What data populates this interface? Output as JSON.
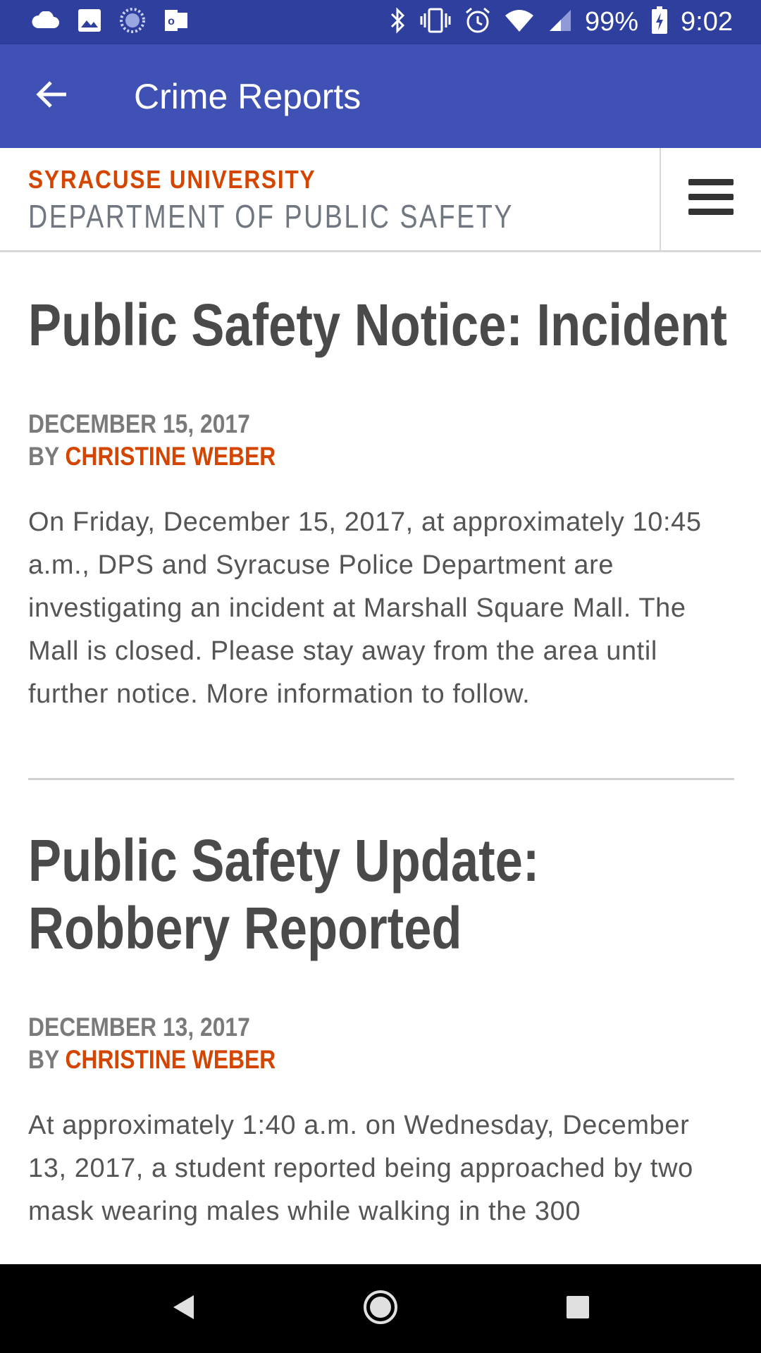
{
  "status_bar": {
    "battery": "99%",
    "time": "9:02",
    "icons_left": [
      "cloud-icon",
      "image-icon",
      "loading-icon",
      "outlook-icon"
    ],
    "icons_right": [
      "bluetooth-icon",
      "vibrate-icon",
      "alarm-icon",
      "wifi-icon",
      "signal-icon",
      "battery-charging-icon"
    ]
  },
  "app_bar": {
    "title": "Crime Reports",
    "back_icon": "arrow-back-icon"
  },
  "site_header": {
    "brand_top": "SYRACUSE UNIVERSITY",
    "brand_bottom": "DEPARTMENT OF PUBLIC SAFETY",
    "menu_icon": "hamburger-menu-icon"
  },
  "articles": [
    {
      "title": "Public Safety Notice: Incident",
      "date": "DECEMBER 15, 2017",
      "by_label": "BY",
      "author": "CHRISTINE WEBER",
      "body": "On Friday, December 15, 2017, at approximately 10:45 a.m., DPS and Syracuse Police Department are investigating an incident at Marshall Square Mall. The Mall is closed. Please stay away from the area until further notice. More information to follow."
    },
    {
      "title": "Public Safety Update: Robbery Reported",
      "date": "DECEMBER 13, 2017",
      "by_label": "BY",
      "author": "CHRISTINE WEBER",
      "body": "At approximately 1:40 a.m. on Wednesday, December 13, 2017, a student reported being approached by two mask wearing males while walking in the 300"
    }
  ],
  "nav_bar": {
    "icons": [
      "nav-back-icon",
      "nav-home-icon",
      "nav-recents-icon"
    ]
  },
  "colors": {
    "status_bar": "#2f3f9e",
    "app_bar": "#3f51b5",
    "accent_orange": "#d44500",
    "heading_gray": "#4a4a4a"
  }
}
